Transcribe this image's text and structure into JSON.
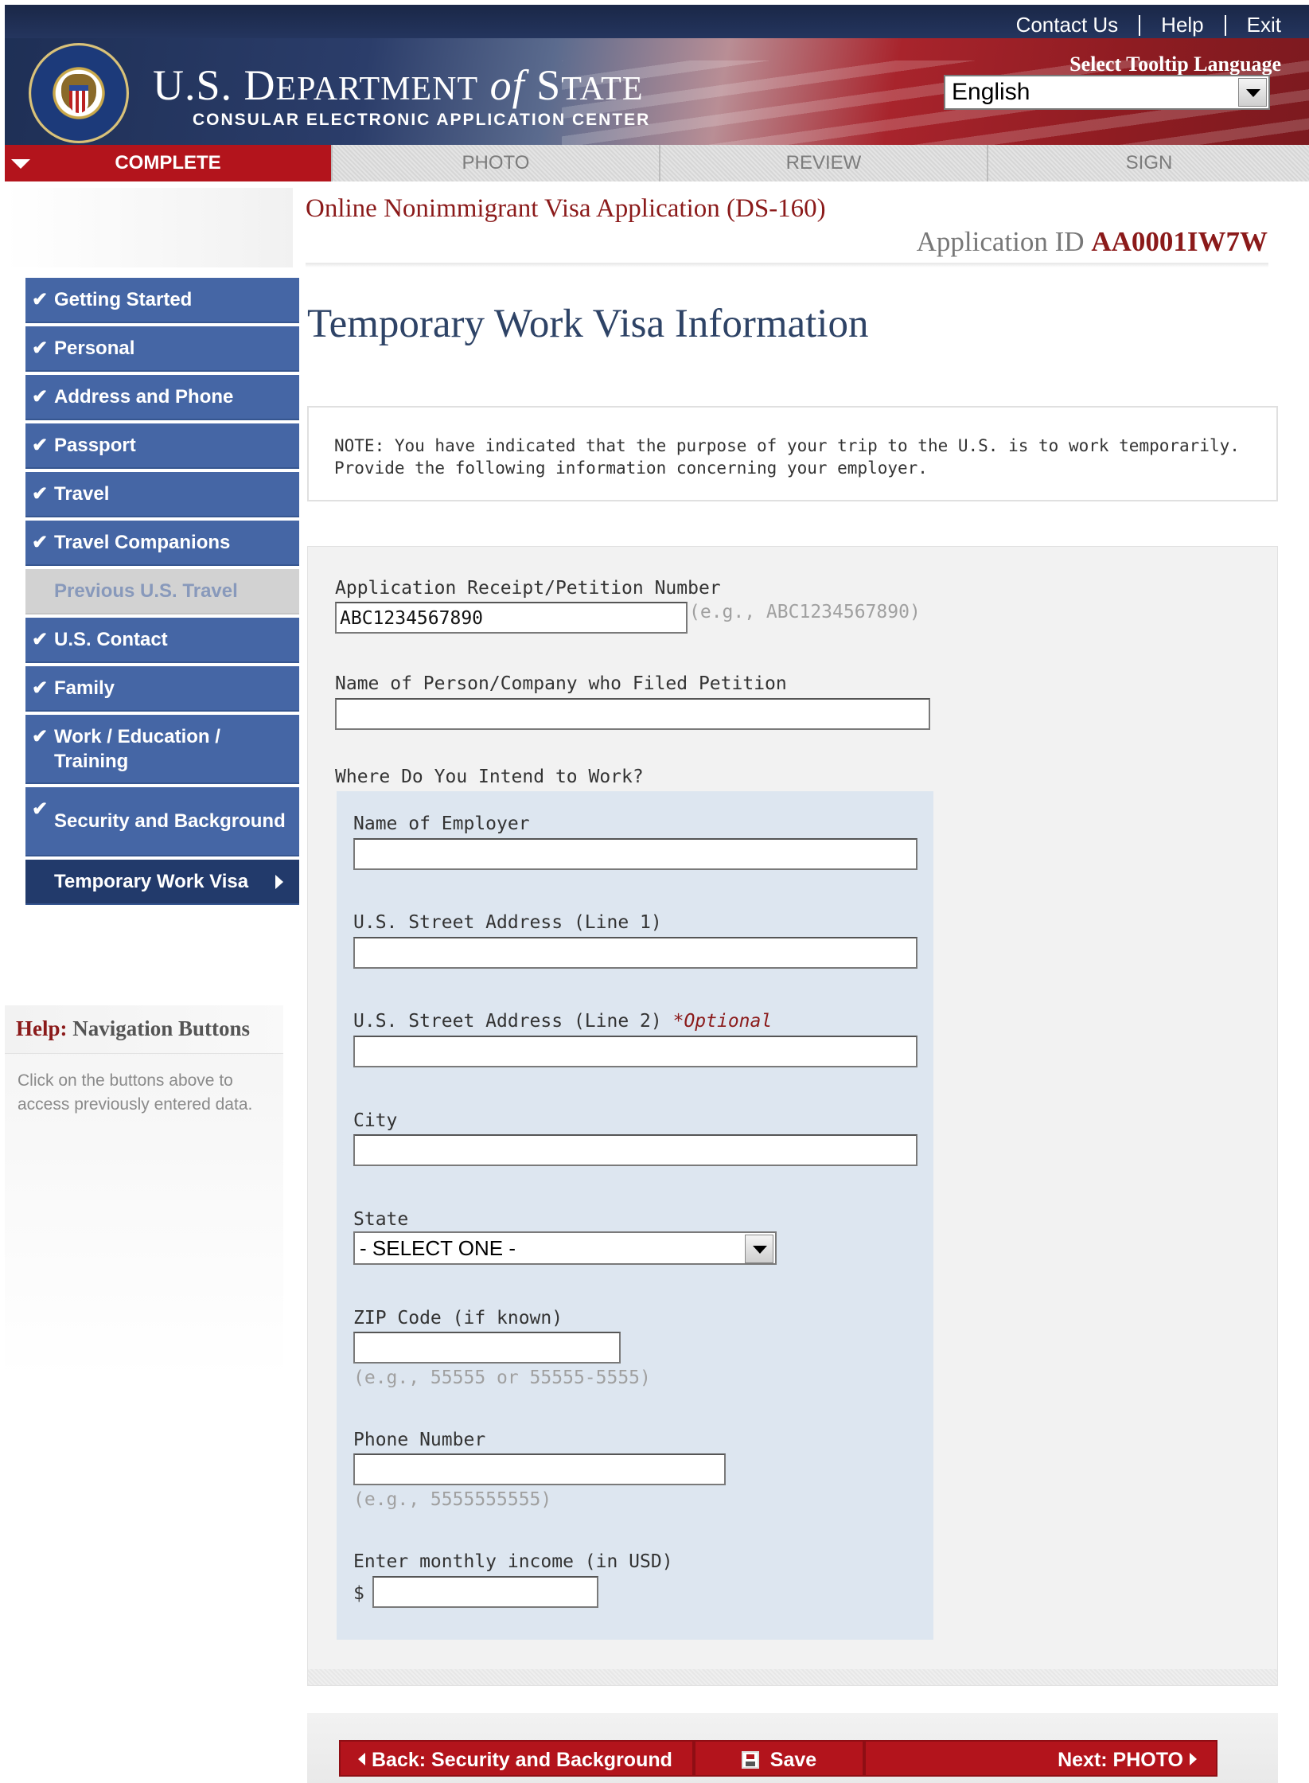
{
  "header": {
    "links": [
      "Contact Us",
      "Help",
      "Exit"
    ],
    "brand_title_pre": "U.S. D",
    "brand_title_epartment": "EPARTMENT",
    "brand_title_of": "of",
    "brand_title_s": "S",
    "brand_title_tate": "TATE",
    "brand_subtitle": "CONSULAR ELECTRONIC APPLICATION CENTER",
    "tooltip_label": "Select Tooltip Language",
    "language_value": "English"
  },
  "progress_tabs": [
    {
      "label": "COMPLETE",
      "active": true
    },
    {
      "label": "PHOTO",
      "active": false
    },
    {
      "label": "REVIEW",
      "active": false
    },
    {
      "label": "SIGN",
      "active": false
    }
  ],
  "application": {
    "title": "Online Nonimmigrant Visa Application (DS-160)",
    "id_label": "Application ID",
    "id_value": "AA0001IW7W"
  },
  "sidebar": {
    "items": [
      {
        "label": "Getting Started",
        "state": "complete"
      },
      {
        "label": "Personal",
        "state": "complete"
      },
      {
        "label": "Address and Phone",
        "state": "complete"
      },
      {
        "label": "Passport",
        "state": "complete"
      },
      {
        "label": "Travel",
        "state": "complete"
      },
      {
        "label": "Travel Companions",
        "state": "complete"
      },
      {
        "label": "Previous U.S. Travel",
        "state": "disabled"
      },
      {
        "label": "U.S. Contact",
        "state": "complete"
      },
      {
        "label": "Family",
        "state": "complete"
      },
      {
        "label": "Work / Education / Training",
        "state": "complete"
      },
      {
        "label": "Security and Background",
        "state": "complete"
      },
      {
        "label": "Temporary Work Visa",
        "state": "current"
      }
    ],
    "check_glyph": "✔"
  },
  "help": {
    "title_prefix": "Help:",
    "title": "Navigation Buttons",
    "text": "Click on the buttons above to access previously entered data."
  },
  "page": {
    "heading": "Temporary Work Visa Information",
    "note_line1": "NOTE: You have indicated that the purpose of your trip to the U.S. is to work temporarily.",
    "note_line2": "Provide the following information concerning your employer."
  },
  "form": {
    "receipt_label": "Application Receipt/Petition Number",
    "receipt_value": "ABC1234567890",
    "receipt_hint": "(e.g., ABC1234567890)",
    "petitioner_label": "Name of Person/Company who Filed Petition",
    "petitioner_value": "",
    "work_location_label": "Where Do You Intend to Work?",
    "employer_label": "Name of Employer",
    "employer_value": "",
    "street1_label": "U.S. Street Address (Line 1)",
    "street1_value": "",
    "street2_label": "U.S. Street Address (Line 2)",
    "street2_optional": "*Optional",
    "street2_value": "",
    "city_label": "City",
    "city_value": "",
    "state_label": "State",
    "state_value": "- SELECT ONE -",
    "zip_label": "ZIP Code (if known)",
    "zip_value": "",
    "zip_hint": "(e.g., 55555 or 55555-5555)",
    "phone_label": "Phone Number",
    "phone_value": "",
    "phone_hint": "(e.g., 5555555555)",
    "income_label": "Enter monthly income (in USD)",
    "income_currency": "$",
    "income_value": ""
  },
  "buttons": {
    "back": "Back: Security and Background",
    "save": "Save",
    "next": "Next: PHOTO"
  },
  "colors": {
    "accent_red": "#b3141c",
    "nav_blue": "#4566a5",
    "nav_current": "#223a6b",
    "heading_blue": "#2e4366",
    "title_maroon": "#8b1a1a"
  }
}
